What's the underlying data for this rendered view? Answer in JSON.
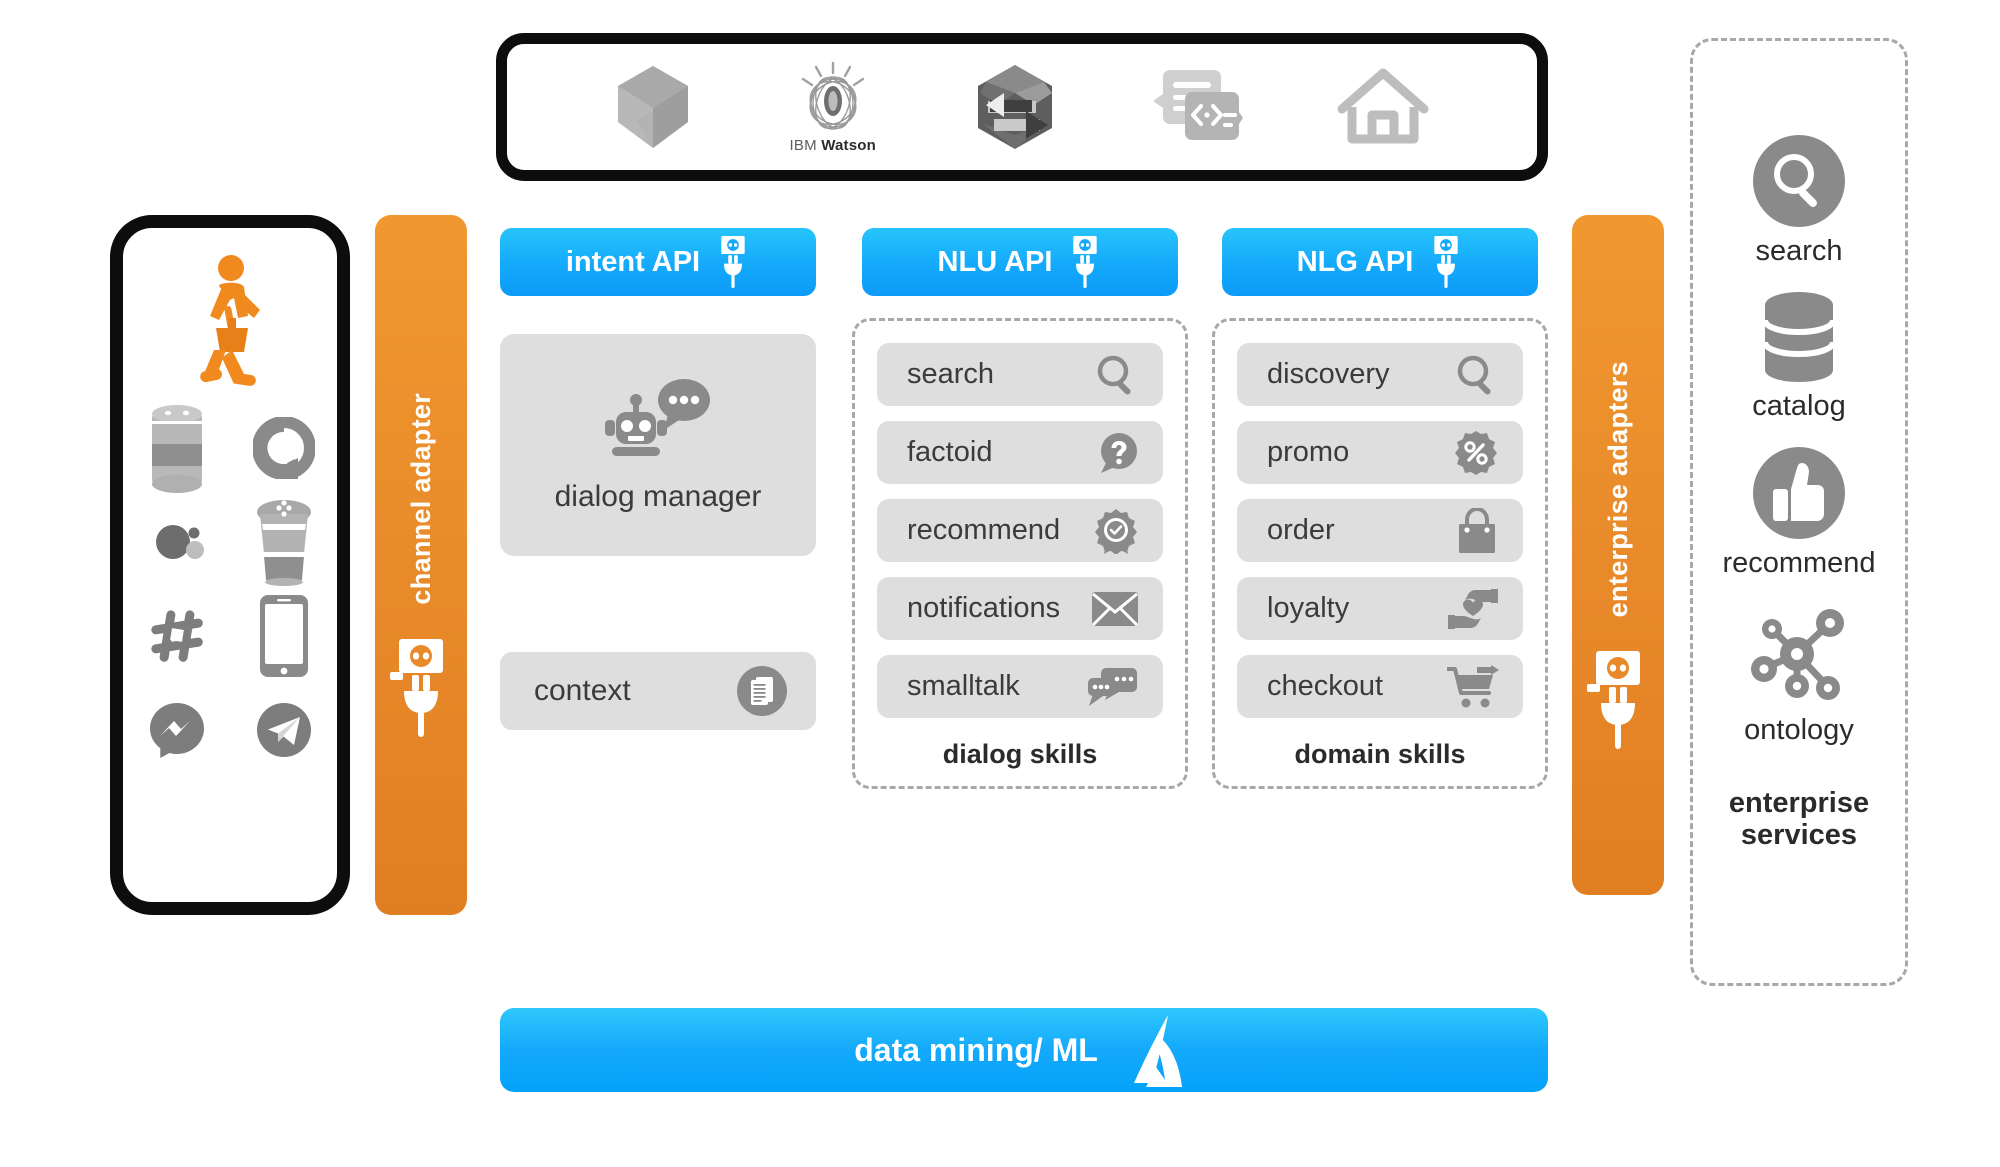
{
  "platform_bar": {
    "logos": [
      {
        "name": "cube-logo-icon",
        "caption": ""
      },
      {
        "name": "ibm-watson-logo-icon",
        "caption": "IBM Watson",
        "caption_light": "IBM",
        "caption_bold": "Watson"
      },
      {
        "name": "data-exchange-hexagon-icon",
        "caption": ""
      },
      {
        "name": "code-document-icon",
        "caption": ""
      },
      {
        "name": "home-outline-icon",
        "caption": ""
      }
    ]
  },
  "device_frame": {
    "shopper_icon": "walking-shopper-icon",
    "shopper_color": "#f08a1e",
    "channels": [
      {
        "name": "echo-speaker-icon"
      },
      {
        "name": "alexa-ring-icon"
      },
      {
        "name": "google-home-mini-icon"
      },
      {
        "name": "google-assistant-dots-icon"
      },
      {
        "name": "google-home-speaker-icon"
      },
      {
        "name": "slack-hash-icon"
      },
      {
        "name": "smartphone-icon"
      },
      {
        "name": "facebook-messenger-icon"
      },
      {
        "name": "telegram-icon"
      }
    ]
  },
  "channel_adapter": {
    "label": "channel adapter",
    "icon": "plug-socket-icon",
    "color": "#e8892a"
  },
  "enterprise_adapter": {
    "label": "enterprise adapters",
    "icon": "plug-socket-icon",
    "color": "#e8892a"
  },
  "apis": {
    "intent": {
      "label": "intent API",
      "icon": "plug-socket-icon"
    },
    "nlu": {
      "label": "NLU API",
      "icon": "plug-socket-icon"
    },
    "nlg": {
      "label": "NLG API",
      "icon": "plug-socket-icon"
    },
    "color": "#12a9fb"
  },
  "intent_column": {
    "dialog_manager": {
      "label": "dialog manager",
      "icon": "robot-chat-icon"
    },
    "context": {
      "label": "context",
      "icon": "documents-icon"
    }
  },
  "dialog_skills": {
    "caption": "dialog skills",
    "items": [
      {
        "label": "search",
        "icon": "magnifier-icon"
      },
      {
        "label": "factoid",
        "icon": "question-bubble-icon"
      },
      {
        "label": "recommend",
        "icon": "award-badge-icon"
      },
      {
        "label": "notifications",
        "icon": "envelope-icon"
      },
      {
        "label": "smalltalk",
        "icon": "chat-bubbles-icon"
      }
    ]
  },
  "domain_skills": {
    "caption": "domain skills",
    "items": [
      {
        "label": "discovery",
        "icon": "magnifier-icon"
      },
      {
        "label": "promo",
        "icon": "percent-badge-icon"
      },
      {
        "label": "order",
        "icon": "shopping-bag-icon"
      },
      {
        "label": "loyalty",
        "icon": "hands-heart-icon"
      },
      {
        "label": "checkout",
        "icon": "shopping-cart-arrow-icon"
      }
    ]
  },
  "enterprise_services": {
    "caption": "enterprise\nservices",
    "caption_line1": "enterprise",
    "caption_line2": "services",
    "items": [
      {
        "label": "search",
        "icon": "magnifier-circle-icon"
      },
      {
        "label": "catalog",
        "icon": "database-stack-icon"
      },
      {
        "label": "recommend",
        "icon": "thumbs-up-circle-icon"
      },
      {
        "label": "ontology",
        "icon": "graph-nodes-icon"
      }
    ]
  },
  "data_mining_bar": {
    "label": "data mining/ ML",
    "icon": "ml-peak-icon",
    "color": "#12a9fb"
  }
}
